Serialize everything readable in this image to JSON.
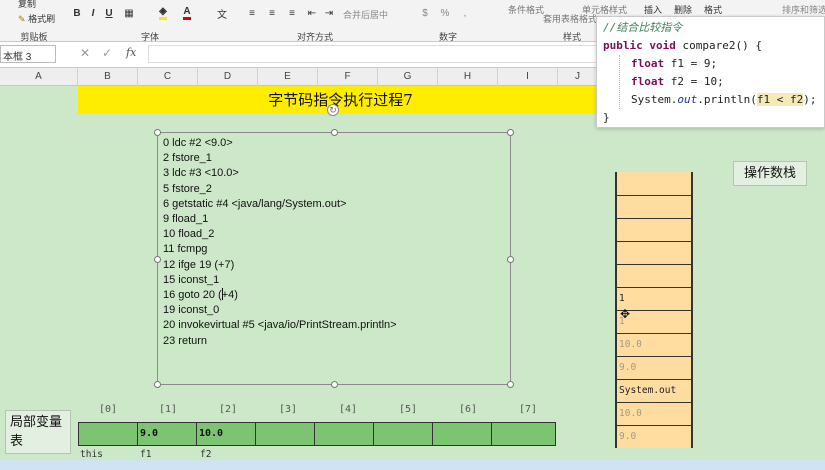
{
  "ribbon": {
    "clipboard_copy": "复制",
    "clipboard_brush": "格式刷",
    "group_clipboard": "剪贴板",
    "group_font": "字体",
    "group_align": "对齐方式",
    "group_number": "数字",
    "group_styles": "样式",
    "merge_center": "合并后居中",
    "conditional_format": "条件格式",
    "table_format": "套用表格格式",
    "cell_style": "单元格样式",
    "insert": "插入",
    "delete": "删除",
    "format": "格式",
    "sort_filter": "排序和筛选",
    "bold": "B",
    "italic": "I",
    "underline": "U"
  },
  "formula_bar": {
    "name_box": "本框 3",
    "fx": "fx"
  },
  "columns": [
    "A",
    "B",
    "C",
    "D",
    "E",
    "F",
    "G",
    "H",
    "I",
    "J"
  ],
  "sheet": {
    "title": "字节码指令执行过程7",
    "bytecode": [
      "0 ldc #2 <9.0>",
      "2 fstore_1",
      "3 ldc #3 <10.0>",
      "5 fstore_2",
      "6 getstatic #4 <java/lang/System.out>",
      "9 fload_1",
      "10 fload_2",
      "11 fcmpg",
      "12 ifge 19 (+7)",
      "15 iconst_1",
      "16 goto 20 (+4)",
      "19 iconst_0",
      "20 invokevirtual #5 <java/io/PrintStream.println>",
      "23 return"
    ],
    "operand_stack_label": "操作数栈",
    "operand_stack": [
      "",
      "",
      "",
      "",
      "",
      "1",
      "1",
      "10.0",
      "9.0",
      "System.out",
      "10.0",
      "9.0"
    ],
    "local_var_label": "局部变量表",
    "local_indices": [
      "[0]",
      "[1]",
      "[2]",
      "[3]",
      "[4]",
      "[5]",
      "[6]",
      "[7]"
    ],
    "local_values": [
      "",
      "9.0",
      "10.0",
      "",
      "",
      "",
      "",
      ""
    ],
    "local_names": [
      "this",
      "f1",
      "f2"
    ]
  },
  "code_popup": {
    "comment": "//结合比较指令",
    "signature_kw": "public void",
    "signature_rest": " compare2() {",
    "line1_kw": "float",
    "line1_rest": " f1 = 9;",
    "line2_kw": "float",
    "line2_rest": " f2 = 10;",
    "line3_pre": "System.",
    "line3_it": "out",
    "line3_mid": ".println(",
    "line3_hl": "f1 < f2",
    "line3_end": ");",
    "closing": "}"
  }
}
